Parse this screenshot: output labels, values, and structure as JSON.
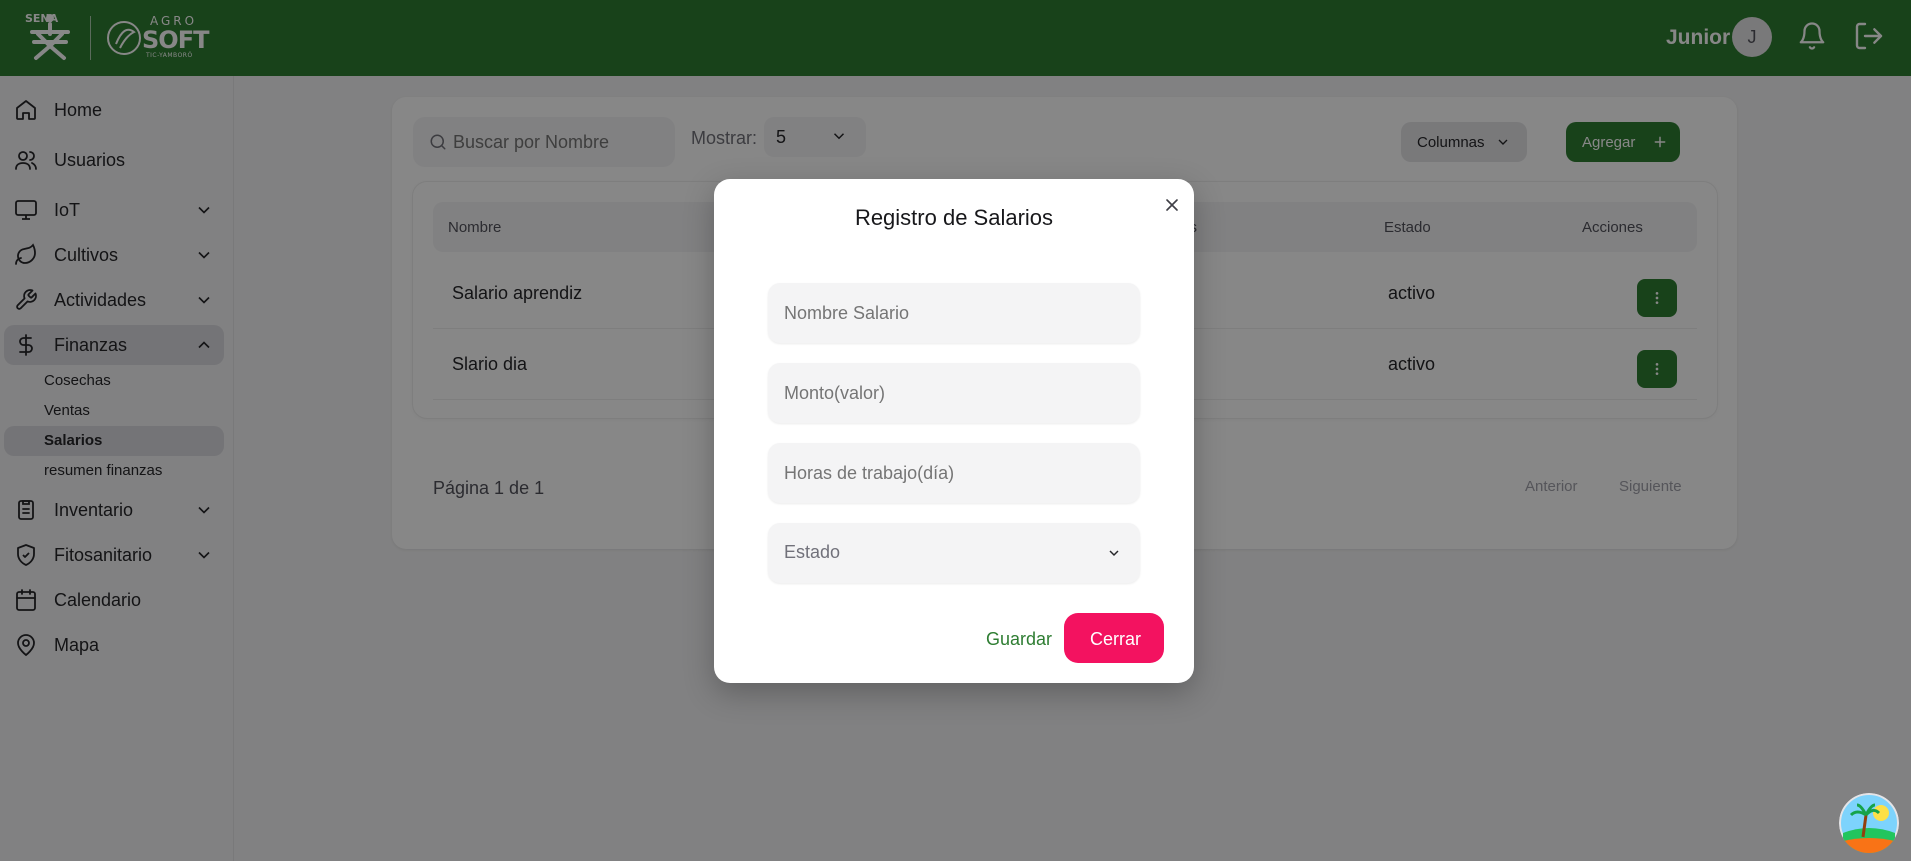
{
  "header": {
    "sena_text": "SENA",
    "agro_top": "AGRO",
    "agro_main": "SOFT",
    "agro_sub": "TIC-YAMBORÓ",
    "user_name": "Junior",
    "avatar_initial": "J",
    "bg_color": "#2e7d32"
  },
  "sidebar": {
    "items": [
      {
        "label": "Home",
        "icon": "home-icon"
      },
      {
        "label": "Usuarios",
        "icon": "users-icon"
      },
      {
        "label": "IoT",
        "icon": "monitor-icon"
      },
      {
        "label": "Cultivos",
        "icon": "leaf-icon"
      },
      {
        "label": "Actividades",
        "icon": "wrench-icon"
      },
      {
        "label": "Finanzas",
        "icon": "dollar-icon"
      },
      {
        "label": "Inventario",
        "icon": "clipboard-icon"
      },
      {
        "label": "Fitosanitario",
        "icon": "shield-check-icon"
      },
      {
        "label": "Calendario",
        "icon": "calendar-icon"
      },
      {
        "label": "Mapa",
        "icon": "map-pin-icon"
      }
    ],
    "finanzas_sub": [
      {
        "label": "Cosechas"
      },
      {
        "label": "Ventas"
      },
      {
        "label": "Salarios"
      },
      {
        "label": "resumen finanzas"
      }
    ]
  },
  "toolbar": {
    "search_placeholder": "Buscar por Nombre",
    "mostrar_label": "Mostrar:",
    "mostrar_value": "5",
    "columnas_label": "Columnas",
    "agregar_label": "Agregar"
  },
  "table": {
    "headers": {
      "nombre": "Nombre",
      "monto_partial": "tos",
      "estado": "Estado",
      "acciones": "Acciones"
    },
    "rows": [
      {
        "nombre": "Salario aprendiz",
        "estado": "activo"
      },
      {
        "nombre": "Slario dia",
        "estado": "activo"
      }
    ]
  },
  "pagination": {
    "text": "Página 1 de 1",
    "prev": "Anterior",
    "next": "Siguiente"
  },
  "modal": {
    "title": "Registro de Salarios",
    "fields": {
      "nombre_placeholder": "Nombre Salario",
      "monto_placeholder": "Monto(valor)",
      "horas_placeholder": "Horas de trabajo(día)",
      "estado_placeholder": "Estado"
    },
    "guardar_label": "Guardar",
    "cerrar_label": "Cerrar",
    "accent_danger": "#f31260"
  }
}
